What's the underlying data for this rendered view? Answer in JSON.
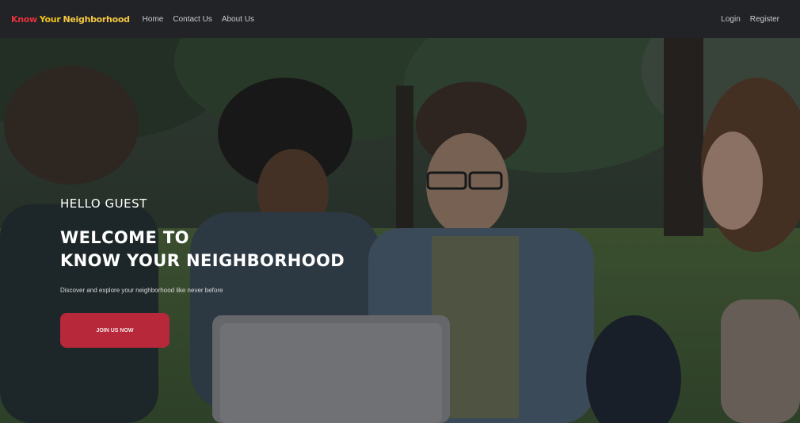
{
  "navbar": {
    "brand": {
      "word1": "Know",
      "word2": "Your",
      "word3": "Neighborhood"
    },
    "links": [
      "Home",
      "Contact Us",
      "About Us"
    ],
    "right_links": [
      "Login",
      "Register"
    ]
  },
  "hero": {
    "greeting": "HELLO GUEST",
    "title_line1": "WELCOME TO",
    "title_line2": "KNOW YOUR NEIGHBORHOOD",
    "subtitle": "Discover and explore your neighborhood like never before",
    "cta_label": "JOIN US NOW"
  },
  "colors": {
    "brand_red": "#e8323c",
    "brand_yellow": "#f0c419",
    "cta": "#b6283a",
    "navbar": "#212327"
  }
}
